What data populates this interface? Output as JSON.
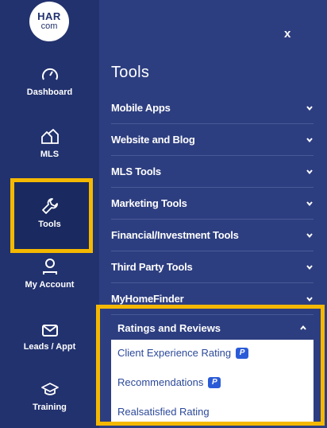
{
  "logo": {
    "line1": "HAR",
    "line2": "com"
  },
  "sidebar": {
    "items": [
      {
        "label": "Dashboard",
        "icon": "speedometer-icon"
      },
      {
        "label": "MLS",
        "icon": "houses-icon"
      },
      {
        "label": "Tools",
        "icon": "wrench-icon",
        "active": true
      },
      {
        "label": "My Account",
        "icon": "user-icon"
      },
      {
        "label": "Leads / Appt",
        "icon": "envelope-icon"
      },
      {
        "label": "Training",
        "icon": "graduation-cap-icon"
      }
    ]
  },
  "panel": {
    "close_label": "x",
    "title": "Tools",
    "menu": [
      {
        "label": "Mobile Apps"
      },
      {
        "label": "Website and Blog"
      },
      {
        "label": "MLS Tools"
      },
      {
        "label": "Marketing Tools"
      },
      {
        "label": "Financial/Investment Tools"
      },
      {
        "label": "Third Party Tools"
      },
      {
        "label": "MyHomeFinder"
      }
    ],
    "expanded": {
      "label": "Ratings and Reviews",
      "items": [
        {
          "label": "Client Experience Rating",
          "badge": "P"
        },
        {
          "label": "Recommendations",
          "badge": "P"
        },
        {
          "label": "Realsatisfied Rating"
        }
      ]
    }
  },
  "colors": {
    "sidebar": "#22326e",
    "panel": "#2d3e80",
    "highlight": "#f5b800",
    "badge": "#2a5bd7"
  }
}
